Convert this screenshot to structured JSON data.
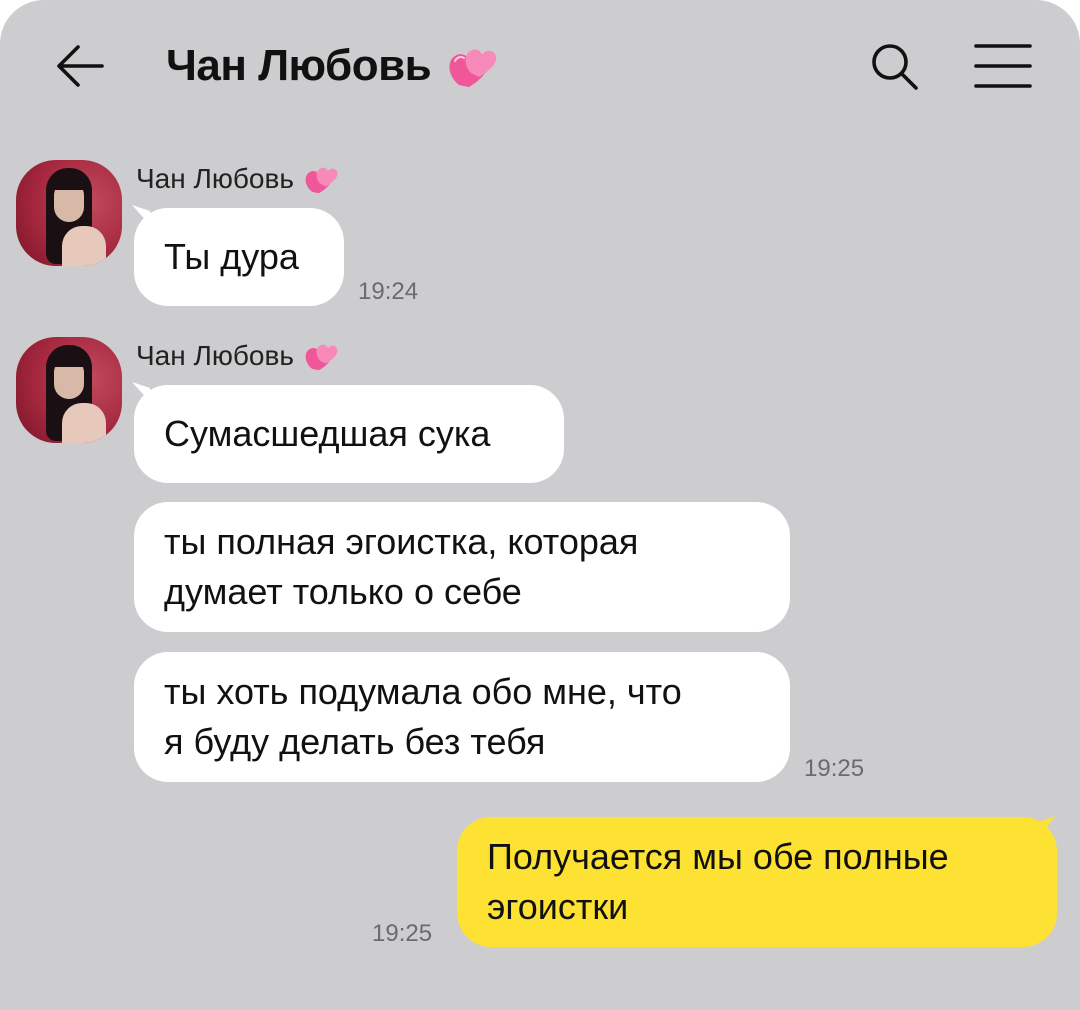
{
  "header": {
    "title": "Чан Любовь",
    "title_emoji": "heart-emoji"
  },
  "icons": {
    "back": "arrow-left-icon",
    "search": "search-icon",
    "menu": "menu-icon"
  },
  "messages": [
    {
      "sender": "Чан Любовь",
      "bubbles": [
        "Ты дура"
      ],
      "time": "19:24"
    },
    {
      "sender": "Чан Любовь",
      "bubbles": [
        "Сумасшедшая сука",
        "ты полная эгоистка, которая\nдумает только о себе",
        "ты хоть подумала обо мне, что\nя буду делать без тебя"
      ],
      "time": "19:25"
    },
    {
      "sender": "",
      "bubbles": [
        "Получается мы обе полные\nэгоистки"
      ],
      "time": "19:25",
      "outgoing": true
    }
  ],
  "colors": {
    "background": "#cdcccf",
    "incoming_bubble": "#ffffff",
    "outgoing_bubble": "#fde233",
    "heart": "#f0569a"
  }
}
